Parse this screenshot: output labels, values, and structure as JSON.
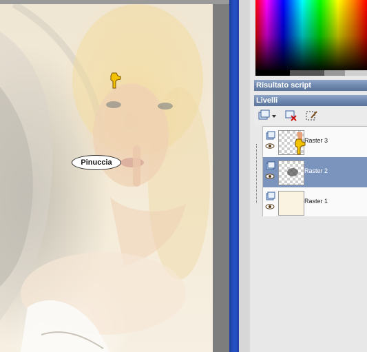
{
  "canvas": {
    "watermark": "Pinuccia"
  },
  "panels": {
    "script_output_title": "Risultato script",
    "layers_title": "Livelli"
  },
  "layers": [
    {
      "name": "Raster 3",
      "selected": false,
      "thumbnail": "transparent-with-shape"
    },
    {
      "name": "Raster 2",
      "selected": true,
      "thumbnail": "transparent-with-shadow"
    },
    {
      "name": "Raster 1",
      "selected": false,
      "thumbnail": "solid-cream"
    }
  ],
  "icons": {
    "canvas_pointer": "pointing-hand-icon",
    "layers_pointer": "pointing-hand-icon",
    "toolbar": [
      "new-raster-layer-icon",
      "delete-layer-icon",
      "edit-selection-icon"
    ]
  },
  "colors": {
    "panel_header": "#6d86ad",
    "selected_layer": "#7b94bd",
    "separator_blue": "#2450c0",
    "canvas_background": "#f2e8d4"
  }
}
